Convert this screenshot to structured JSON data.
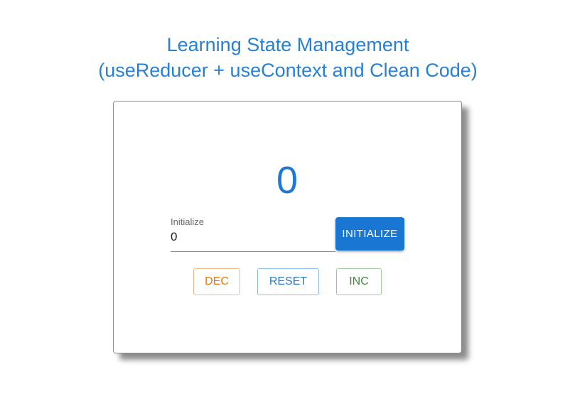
{
  "header": {
    "title_line1": "Learning State Management",
    "title_line2": "(useReducer + useContext and Clean Code)"
  },
  "counter": {
    "value": "0"
  },
  "initialize_field": {
    "label": "Initialize",
    "value": "0"
  },
  "buttons": {
    "initialize": "INITIALIZE",
    "dec": "DEC",
    "reset": "RESET",
    "inc": "INC"
  },
  "colors": {
    "primary": "#1976d2",
    "title": "#2680d6",
    "dec": "#e07a1a",
    "reset": "#2b7bcc",
    "inc": "#3a8a3a"
  }
}
